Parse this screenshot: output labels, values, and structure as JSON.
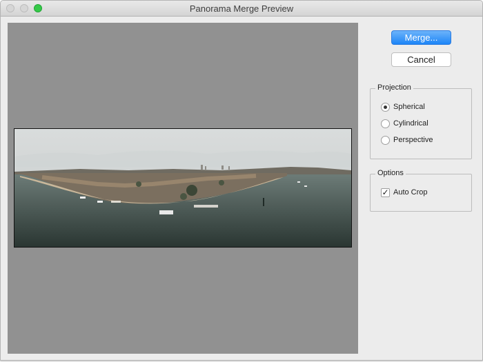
{
  "window": {
    "title": "Panorama Merge Preview"
  },
  "actions": {
    "merge_label": "Merge...",
    "cancel_label": "Cancel"
  },
  "projection": {
    "legend": "Projection",
    "options": [
      {
        "label": "Spherical",
        "selected": true
      },
      {
        "label": "Cylindrical",
        "selected": false
      },
      {
        "label": "Perspective",
        "selected": false
      }
    ]
  },
  "options": {
    "legend": "Options",
    "auto_crop": {
      "label": "Auto Crop",
      "checked": true
    }
  },
  "colors": {
    "accent": "#1d85f7",
    "preview_bg": "#919191",
    "window_bg": "#ececec",
    "zoom_button": "#35c948"
  },
  "icons": {
    "close": "close-icon",
    "minimize": "minimize-icon",
    "zoom": "zoom-icon"
  }
}
